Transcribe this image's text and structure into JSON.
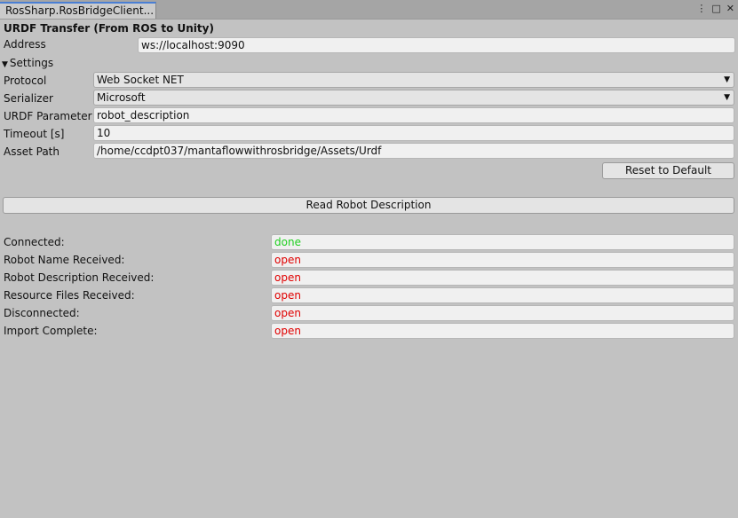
{
  "tab": {
    "title": "RosSharp.RosBridgeClient..."
  },
  "window_icons": {
    "menu": "⋮",
    "maximize": "□",
    "close": "✕"
  },
  "header": {
    "title": "URDF Transfer (From ROS to Unity)"
  },
  "address": {
    "label": "Address",
    "value": "ws://localhost:9090"
  },
  "settings": {
    "label": "Settings",
    "protocol": {
      "label": "Protocol",
      "value": "Web Socket NET"
    },
    "serializer": {
      "label": "Serializer",
      "value": "Microsoft"
    },
    "urdf_parameter": {
      "label": "URDF Parameter",
      "value": "robot_description"
    },
    "timeout": {
      "label": "Timeout [s]",
      "value": "10"
    },
    "asset_path": {
      "label": "Asset Path",
      "value": "/home/ccdpt037/mantaflowwithrosbridge/Assets/Urdf"
    },
    "reset_label": "Reset to Default"
  },
  "read_button_label": "Read Robot Description",
  "status": [
    {
      "label": "Connected:",
      "value": "done",
      "state": "done"
    },
    {
      "label": "Robot Name Received:",
      "value": "open",
      "state": "open"
    },
    {
      "label": "Robot Description Received:",
      "value": "open",
      "state": "open"
    },
    {
      "label": "Resource Files Received:",
      "value": "open",
      "state": "open"
    },
    {
      "label": "Disconnected:",
      "value": "open",
      "state": "open"
    },
    {
      "label": "Import Complete:",
      "value": "open",
      "state": "open"
    }
  ],
  "colors": {
    "done": "#20d020",
    "open": "#e00000",
    "tab_accent": "#4a7fd4"
  }
}
